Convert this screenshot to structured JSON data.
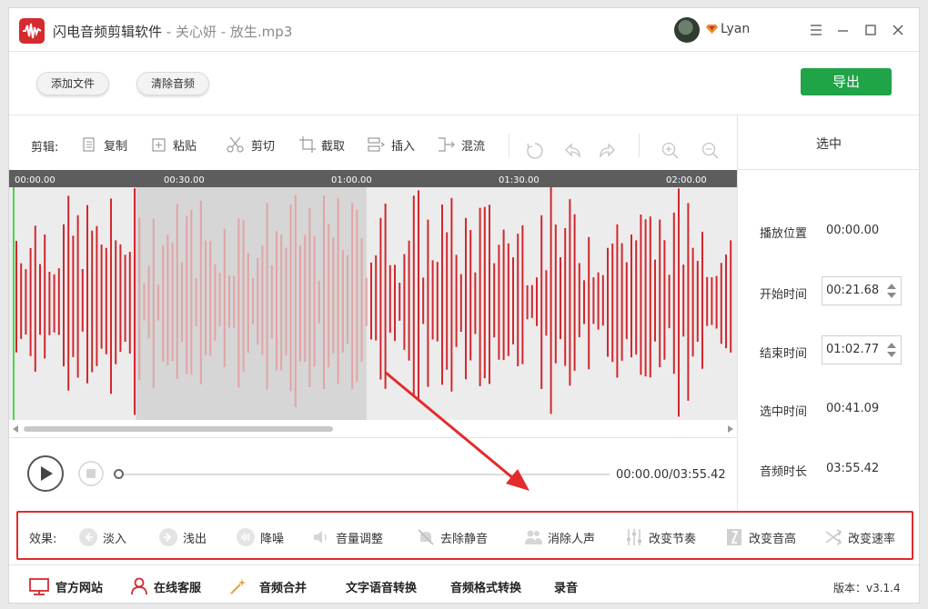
{
  "titlebar": {
    "app_name": "闪电音频剪辑软件",
    "separator": " - ",
    "file_label": "关心妍 - 放生.mp3",
    "user_name": "Lyan",
    "menu_icon": "hamburger-icon",
    "minimize_icon": "minimize-icon",
    "maximize_icon": "maximize-icon",
    "close_icon": "close-icon"
  },
  "toolbar": {
    "add_file": "添加文件",
    "clear_audio": "清除音频",
    "export": "导出"
  },
  "edit": {
    "label": "剪辑:",
    "tools": [
      {
        "label": "复制",
        "icon": "copy-icon"
      },
      {
        "label": "粘贴",
        "icon": "paste-icon"
      },
      {
        "label": "剪切",
        "icon": "scissors-icon"
      },
      {
        "label": "截取",
        "icon": "crop-icon"
      },
      {
        "label": "插入",
        "icon": "insert-icon"
      },
      {
        "label": "混流",
        "icon": "mix-icon"
      }
    ]
  },
  "timeline": {
    "ticks": [
      "00:00.00",
      "00:30.00",
      "01:00.00",
      "01:30.00",
      "02:00.00"
    ]
  },
  "waveform": {
    "selection_start_fraction": 0.174,
    "selection_end_fraction": 0.491,
    "accent_color": "#d2282e",
    "selected_color": "#e3a3a5",
    "background_color": "#ececec",
    "selection_background": "#d6d6d6"
  },
  "player": {
    "time_readout": "00:00.00/03:55.42",
    "progress_fraction": 0
  },
  "selection_panel": {
    "title": "选中",
    "play_position_label": "播放位置",
    "play_position_value": "00:00.00",
    "start_label": "开始时间",
    "start_value": "00:21.68",
    "end_label": "结束时间",
    "end_value": "01:02.77",
    "selected_label": "选中时间",
    "selected_value": "00:41.09",
    "duration_label": "音频时长",
    "duration_value": "03:55.42"
  },
  "effects": {
    "label": "效果:",
    "items": [
      {
        "label": "淡入",
        "icon": "fade-in-icon"
      },
      {
        "label": "浅出",
        "icon": "fade-out-icon"
      },
      {
        "label": "降噪",
        "icon": "noise-reduction-icon"
      },
      {
        "label": "音量调整",
        "icon": "volume-icon"
      },
      {
        "label": "去除静音",
        "icon": "mute-icon"
      },
      {
        "label": "消除人声",
        "icon": "vocal-remove-icon"
      },
      {
        "label": "改变节奏",
        "icon": "tempo-icon"
      },
      {
        "label": "改变音高",
        "icon": "pitch-icon"
      },
      {
        "label": "改变速率",
        "icon": "speed-icon"
      }
    ]
  },
  "bottom": {
    "website": "官方网站",
    "support": "在线客服",
    "merge": "音频合并",
    "tts": "文字语音转换",
    "convert": "音频格式转换",
    "record": "录音",
    "version": "版本：v3.1.4"
  },
  "colors": {
    "brand": "#d52a2f",
    "export_green": "#21a348",
    "highlight_red": "#e32b2b"
  }
}
